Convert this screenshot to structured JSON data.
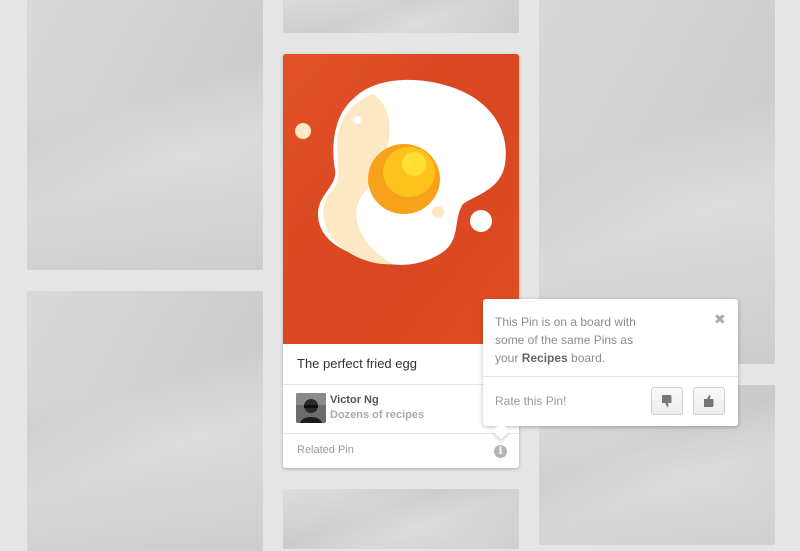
{
  "pin": {
    "title": "The perfect fried egg",
    "author": "Victor Ng",
    "board": "Dozens of recipes",
    "related_label": "Related Pin",
    "info_glyph": "i",
    "image_icon": "fried-egg-illustration",
    "image_bg_color": "#de4a23"
  },
  "popover": {
    "line1": "This Pin is on a board with",
    "line2": "some of the same Pins as",
    "line3_prefix": "your ",
    "board_highlight": "Recipes",
    "line3_suffix": " board.",
    "close_glyph": "✖",
    "rate_label": "Rate this Pin!",
    "thumbs_down_icon": "thumbs-down-icon",
    "thumbs_up_icon": "thumbs-up-icon"
  }
}
